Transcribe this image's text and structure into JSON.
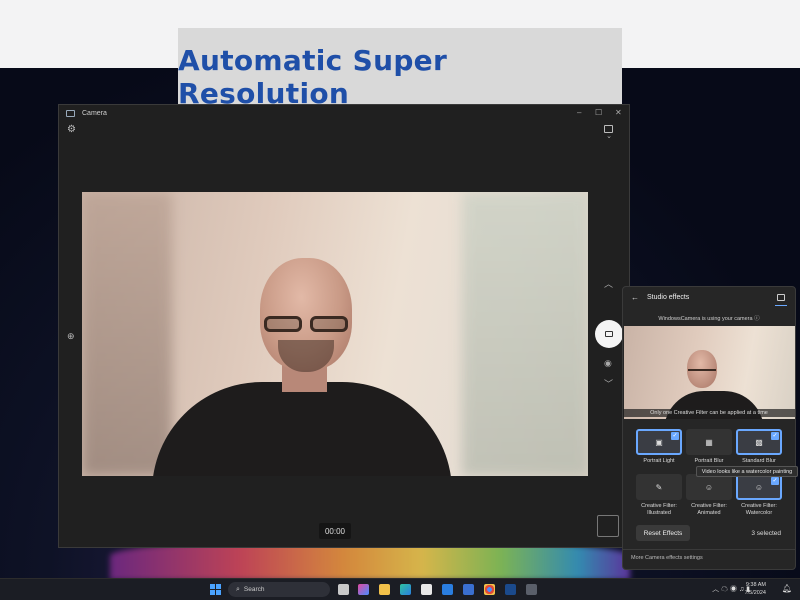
{
  "banner": {
    "title": "Automatic Super Resolution"
  },
  "camera_window": {
    "title": "Camera",
    "controls": {
      "minimize": "–",
      "maximize": "☐",
      "close": "✕"
    },
    "timer": "00:00"
  },
  "studio_effects": {
    "title": "Studio effects",
    "usage_note": "WindowsCamera is using your camera",
    "filter_note": "Only one Creative Filter can be applied at a time",
    "tiles": [
      {
        "label": "Portrait Light",
        "selected": true
      },
      {
        "label": "Portrait Blur",
        "selected": false
      },
      {
        "label": "Standard Blur",
        "selected": true
      },
      {
        "label": "Creative Filter: Illustrated",
        "selected": false
      },
      {
        "label": "Creative Filter: Animated",
        "selected": false
      },
      {
        "label": "Creative Filter: Watercolor",
        "selected": true
      }
    ],
    "tooltip": "Video looks like a watercolor painting",
    "reset_label": "Reset Effects",
    "selected_count": "3 selected",
    "more_link": "More Camera effects settings"
  },
  "taskbar": {
    "search_placeholder": "Search",
    "time": "9:38 AM",
    "date": "7/5/2024"
  },
  "colors": {
    "accent": "#6aa8ff",
    "banner_text": "#1f4fa8"
  }
}
